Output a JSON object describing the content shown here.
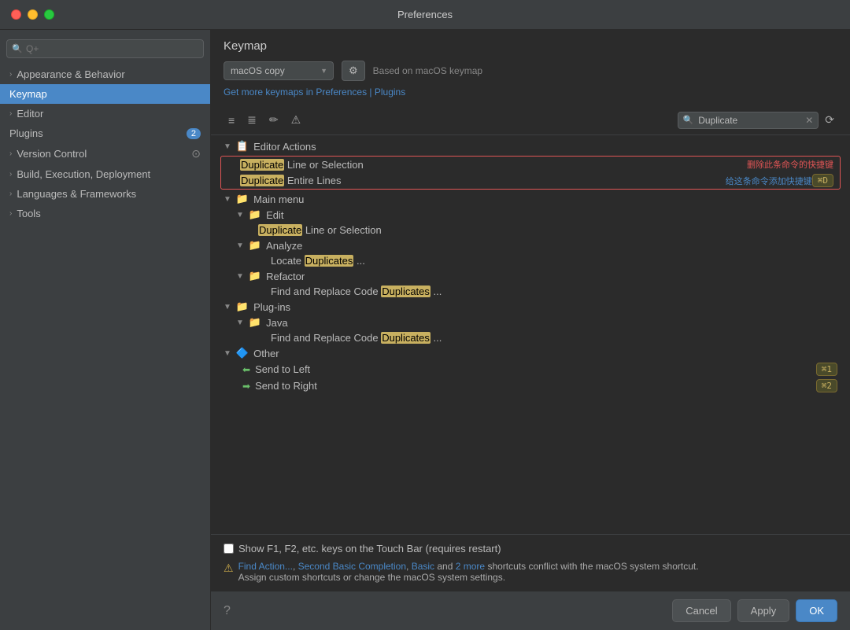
{
  "titlebar": {
    "title": "Preferences"
  },
  "sidebar": {
    "search_placeholder": "Q+",
    "items": [
      {
        "id": "appearance",
        "label": "Appearance & Behavior",
        "chevron": "›",
        "active": false,
        "badge": null
      },
      {
        "id": "keymap",
        "label": "Keymap",
        "active": true,
        "badge": null
      },
      {
        "id": "editor",
        "label": "Editor",
        "chevron": "›",
        "active": false,
        "badge": null
      },
      {
        "id": "plugins",
        "label": "Plugins",
        "active": false,
        "badge": "2"
      },
      {
        "id": "version-control",
        "label": "Version Control",
        "chevron": "›",
        "active": false,
        "badge": null
      },
      {
        "id": "build",
        "label": "Build, Execution, Deployment",
        "chevron": "›",
        "active": false,
        "badge": null
      },
      {
        "id": "languages",
        "label": "Languages & Frameworks",
        "chevron": "›",
        "active": false,
        "badge": null
      },
      {
        "id": "tools",
        "label": "Tools",
        "chevron": "›",
        "active": false,
        "badge": null
      }
    ]
  },
  "panel": {
    "title": "Keymap",
    "keymap_value": "macOS copy",
    "based_on": "Based on macOS keymap",
    "get_more_link": "Get more keymaps in Preferences | Plugins",
    "search_value": "Duplicate"
  },
  "toolbar": {
    "icons": [
      "expand-icon",
      "collapse-icon",
      "edit-icon",
      "warning-icon"
    ]
  },
  "tree": {
    "editor_actions_label": "Editor Actions",
    "items": [
      {
        "id": "duplicate-line",
        "label_pre": "Duplicate",
        "label_post": " Line or Selection",
        "action_remove": "删除此条命令的快捷键",
        "action_add": null,
        "shortcut": null,
        "indent": 1,
        "highlighted": true,
        "grouped": true
      },
      {
        "id": "duplicate-entire",
        "label_pre": "Duplicate",
        "label_post": " Entire Lines",
        "action_remove": null,
        "action_add": "给这条命令添加快捷键",
        "shortcut": "⌘D",
        "indent": 1,
        "highlighted": true,
        "grouped": true
      }
    ],
    "main_menu": {
      "label": "Main menu",
      "edit": {
        "label": "Edit",
        "items": [
          {
            "label_pre": "Duplicate",
            "label_post": " Line or Selection",
            "indent": 3
          }
        ]
      },
      "analyze": {
        "label": "Analyze",
        "items": [
          {
            "label_pre": "Locate ",
            "label_highlight": "Duplicates",
            "label_post": "...",
            "indent": 4
          }
        ]
      },
      "refactor": {
        "label": "Refactor",
        "items": [
          {
            "label_pre": "Find and Replace Code ",
            "label_highlight": "Duplicates",
            "label_post": "...",
            "indent": 4
          }
        ]
      }
    },
    "plugins": {
      "label": "Plug-ins",
      "java": {
        "label": "Java",
        "items": [
          {
            "label_pre": "Find and Replace Code ",
            "label_highlight": "Duplicates",
            "label_post": "...",
            "indent": 4
          }
        ]
      }
    },
    "other": {
      "label": "Other",
      "items": [
        {
          "label": "Send to Left",
          "shortcut": "⌘1",
          "indent": 2
        },
        {
          "label": "Send to Right",
          "shortcut": "⌘2",
          "indent": 2
        }
      ]
    }
  },
  "bottom": {
    "checkbox_label": "Show F1, F2, etc. keys on the Touch Bar (requires restart)",
    "warning_text": "Find Action..., Second Basic Completion, Basic and 2 more shortcuts conflict with the macOS system shortcut. Assign custom shortcuts or change the macOS system settings.",
    "conflict_links": [
      "Find Action...",
      "Second Basic Completion",
      "Basic",
      "2 more"
    ]
  },
  "footer": {
    "cancel_label": "Cancel",
    "apply_label": "Apply",
    "ok_label": "OK"
  }
}
